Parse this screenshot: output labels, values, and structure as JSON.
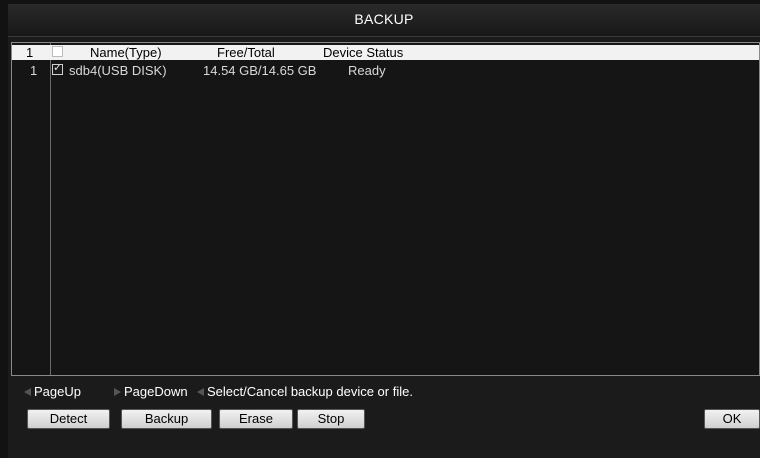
{
  "window": {
    "title": "BACKUP"
  },
  "table": {
    "header": {
      "index": "1",
      "name": "Name(Type)",
      "free_total": "Free/Total",
      "status": "Device Status"
    },
    "rows": [
      {
        "index": "1",
        "checked": true,
        "name": "sdb4(USB DISK)",
        "free_total": "14.54 GB/14.65 GB",
        "status": "Ready"
      }
    ]
  },
  "nav": {
    "page_up": "PageUp",
    "page_down": "PageDown",
    "hint": "Select/Cancel backup device or file."
  },
  "buttons": {
    "detect": "Detect",
    "backup": "Backup",
    "erase": "Erase",
    "stop": "Stop",
    "ok": "OK"
  },
  "icons": {
    "page_up": "left-arrow-icon",
    "page_down": "right-arrow-icon",
    "checkbox_checked": "checkmark-icon"
  }
}
